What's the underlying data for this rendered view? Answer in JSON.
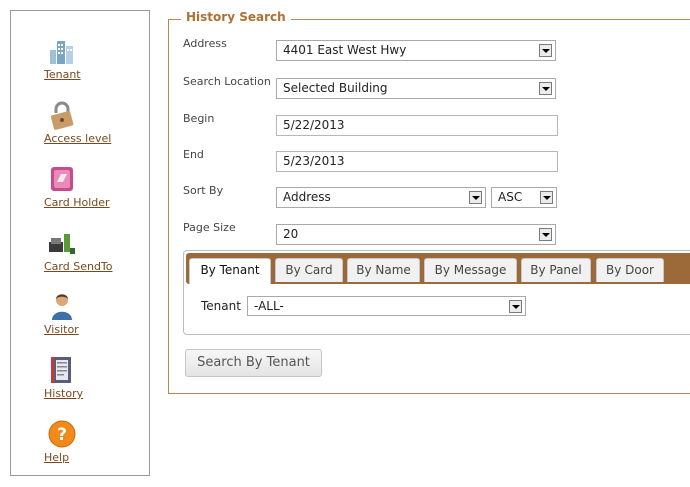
{
  "sidebar": {
    "items": [
      {
        "label": "Tenant",
        "icon": "building-icon"
      },
      {
        "label": "Access level",
        "icon": "padlock-icon"
      },
      {
        "label": "Card Holder",
        "icon": "card-holder-icon"
      },
      {
        "label": "Card SendTo",
        "icon": "card-sendto-icon"
      },
      {
        "label": "Visitor",
        "icon": "visitor-icon"
      },
      {
        "label": "History",
        "icon": "history-icon"
      },
      {
        "label": "Help",
        "icon": "help-icon"
      }
    ]
  },
  "form": {
    "legend": "History Search",
    "address": {
      "label": "Address",
      "value": "4401 East West Hwy"
    },
    "search_location": {
      "label": "Search Location",
      "value": "Selected Building"
    },
    "begin": {
      "label": "Begin",
      "value": "5/22/2013"
    },
    "end": {
      "label": "End",
      "value": "5/23/2013"
    },
    "sort_by": {
      "label": "Sort By",
      "value": "Address",
      "order": "ASC"
    },
    "page_size": {
      "label": "Page Size",
      "value": "20"
    }
  },
  "tabs": {
    "items": [
      "By Tenant",
      "By Card",
      "By Name",
      "By Message",
      "By Panel",
      "By Door"
    ],
    "active": "By Tenant"
  },
  "tenant_filter": {
    "label": "Tenant",
    "value": "-ALL-"
  },
  "search_button": {
    "label": "Search By Tenant"
  },
  "colors": {
    "accent": "#b0702f",
    "tabbar": "#9b6a38",
    "link": "#7a4a1e"
  }
}
